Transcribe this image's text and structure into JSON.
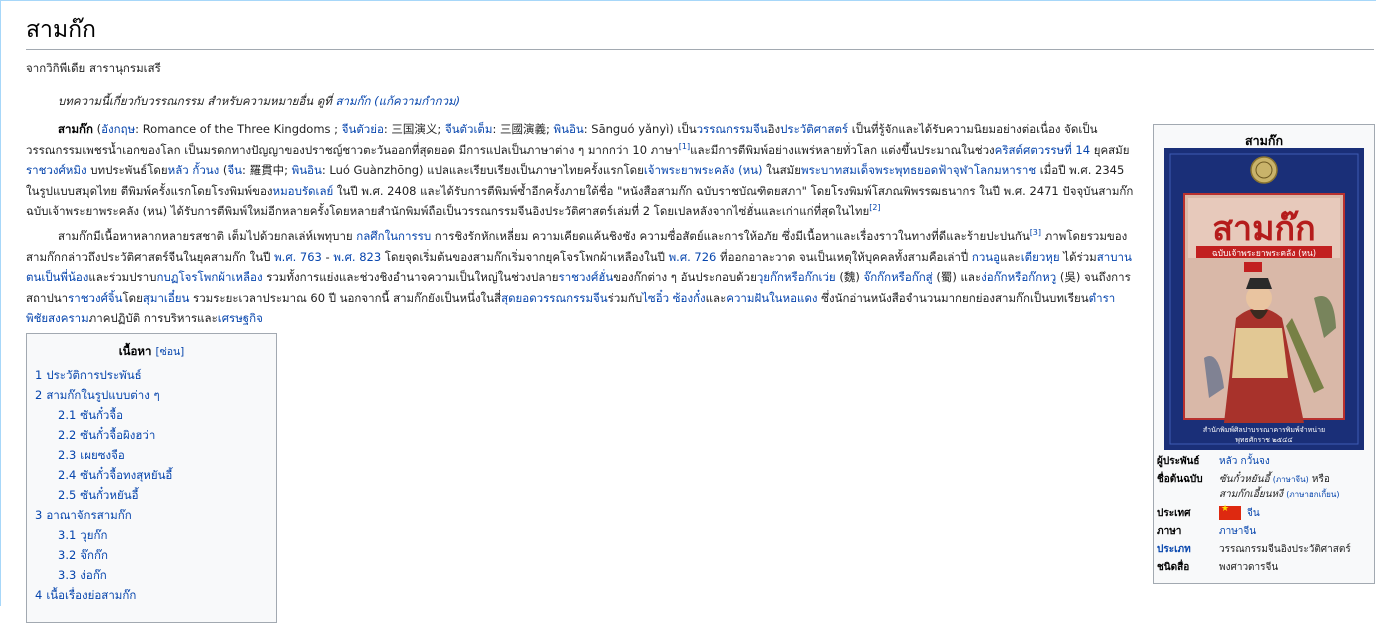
{
  "page": {
    "title": "สามก๊ก",
    "site_sub": "จากวิกิพีเดีย สารานุกรมเสรี",
    "hatnote": {
      "text": "บทความนี้เกี่ยวกับวรรณกรรม สำหรับความหมายอื่น ดูที่ ",
      "link": "สามก๊ก (แก้ความกำกวม)"
    }
  },
  "paragraph1": {
    "bold": "สามก๊ก",
    "t1": " (",
    "l_english": "อังกฤษ",
    "t2": ": Romance of the Three Kingdoms ; ",
    "l_simp": "จีนตัวย่อ",
    "t3": ": 三国演义; ",
    "l_trad": "จีนตัวเต็ม",
    "t4": ": 三國演義; ",
    "l_pinyin": "พินอิน",
    "t5": ": Sānguó yǎnyì) เป็น",
    "l_lit": "วรรณกรรม",
    "l_china": "จีน",
    "t6": "อิง",
    "l_hist": "ประวัติศาสตร์",
    "t7": " เป็นที่รู้จักและได้รับความนิยมอย่างต่อเนื่อง จัดเป็นวรรณกรรมเพชรน้ำเอกของโลก เป็นมรดกทางปัญญาของปราชญ์ชาวตะวันออกที่สุดยอด มีการแปลเป็นภาษาต่าง ๆ มากกว่า 10 ภาษา",
    "ref1": "[1]",
    "t8": "และมีการตีพิมพ์อย่างแพร่หลายทั่วโลก แต่งขึ้นประมาณในช่วง",
    "l_century": "คริสต์ศตวรรษที่ 14",
    "t9": " ยุคสมัย",
    "l_ming": "ราชวงศ์หมิง",
    "t10": " บทประพันธ์โดย",
    "l_luo": "หลัว กั้วนง",
    "t11": " (",
    "l_china2": "จีน",
    "t12": ": 羅貫中; ",
    "l_pinyin2": "พินอิน",
    "t13": ": Luó Guànzhōng) แปลและเรียบเรียงเป็นภาษาไทยครั้งแรกโดย",
    "l_hon": "เจ้าพระยาพระคลัง (หน)",
    "t14": " ในสมัย",
    "l_king": "พระบาทสมเด็จพระพุทธยอดฟ้าจุฬาโลกมหาราช",
    "t15": " เมื่อปี พ.ศ. 2345 ในรูปแบบสมุดไทย ตีพิมพ์ครั้งแรกโดยโรงพิมพ์ของ",
    "l_bradley": "หมอบรัดเลย์",
    "t16": " ในปี พ.ศ. 2408 และได้รับการตีพิมพ์ซ้ำอีกครั้งภายใต้ชื่อ \"หนังสือสามก๊ก ฉบับราชบัณฑิตยสภา\" โดยโรงพิมพ์โสภณพิพรรฒธนากร ในปี พ.ศ. 2471 ปัจจุบันสามก๊กฉบับเจ้าพระยาพระคลัง (หน) ได้รับการตีพิมพ์ใหม่อีกหลายครั้งโดยหลายสำนักพิมพ์ถือเป็นวรรณกรรมจีนอิงประวัติศาสตร์เล่มที่ 2 โดยเปลหลังจากไซ่ฮั่นและเก่าแก่ที่สุดในไทย",
    "ref2": "[2]"
  },
  "paragraph2": {
    "t1": "สามก๊กมีเนื้อหาหลากหลายรสชาติ เต็มไปด้วยกลเล่ห์เพทุบาย ",
    "l_tactics": "กลศึกในการรบ",
    "t2": " การชิงรักหักเหลี่ยม ความเคียดแค้นชิงชัง ความซื่อสัตย์และการให้อภัย ซึ่งมีเนื้อหาและเรื่องราวในทางที่ดีและร้ายปะปนกัน",
    "ref3": "[3]",
    "t3": " ภาพโดยรวมของสามก๊กกล่าวถึงประวัติศาสตร์จีนในยุคสามก๊ก ในปี ",
    "l_763": "พ.ศ. 763",
    "t4": " - ",
    "l_823": "พ.ศ. 823",
    "t5": " โดยจุดเริ่มต้นของสามก๊กเริ่มจากยุคโจรโพกผ้าเหลืองในปี ",
    "l_726": "พ.ศ. 726",
    "t6": " ที่ออกอาละวาด จนเป็นเหตุให้บุคคลทั้งสามคือเล่าปี่ ",
    "l_guanyu": "กวนอู",
    "t7": "และ",
    "l_zhangfei": "เตียวหุย",
    "t8": " ได้ร่วม",
    "l_oath": "สาบานตนเป็นพี่น้อง",
    "t9": "และร่วมปราบ",
    "l_rebels": "กบฏโจรโพกผ้าเหลือง",
    "t10": " รวมทั้งการแย่งและช่วงชิงอำนาจความเป็นใหญ่ในช่วงปลาย",
    "l_han": "ราชวงศ์ฮั่น",
    "t11": "ของก๊กต่าง ๆ อันประกอบด้วย",
    "l_wei": "วุยก๊กหรือก๊กเว่ย",
    "t12": " (魏) ",
    "l_shu": "จ๊กก๊กหรือก๊กสู่",
    "t13": " (蜀) และ",
    "l_wu": "ง่อก๊กหรือก๊กหวู",
    "t14": " (吳) จนถึงการสถาปนา",
    "l_jin": "ราชวงศ์จิ้น",
    "t15": "โดย",
    "l_sima": "สุมาเอี๋ยน",
    "t16": " รวมระยะเวลาประมาณ 60 ปี นอกจากนี้ สามก๊กยังเป็นหนึ่งในสี่",
    "l_four": "สุดยอดวรรณกรรมจีน",
    "t17": "ร่วมกับ",
    "l_xiyou": "ไซอิ๋ว",
    "t18": " ",
    "l_water": "ซ้องกั๋ง",
    "t19": "และ",
    "l_dream": "ความฝันในหอแดง",
    "t20": " ซึ่งนักอ่านหนังสือจำนวนมากยกย่องสามก๊กเป็นบทเรียน",
    "l_war": "ตำราพิชัยสงคราม",
    "t21": "ภาคปฏิบัติ การบริหารและ",
    "l_econ": "เศรษฐกิจ"
  },
  "toc": {
    "title": "เนื้อหา",
    "toggle": "[ซ่อน]",
    "items": [
      {
        "num": "1",
        "label": "ประวัติการประพันธ์",
        "level": 1
      },
      {
        "num": "2",
        "label": "สามก๊กในรูปแบบต่าง ๆ",
        "level": 1
      },
      {
        "num": "2.1",
        "label": "ซันกั๋วจื้อ",
        "level": 2
      },
      {
        "num": "2.2",
        "label": "ซันกั๋วจื้อผิงฮว่า",
        "level": 2
      },
      {
        "num": "2.3",
        "label": "เผยซงจือ",
        "level": 2
      },
      {
        "num": "2.4",
        "label": "ซันกั๋วจื้อทงสุหยันอี้",
        "level": 2
      },
      {
        "num": "2.5",
        "label": "ซันกั๋วหยันอี้",
        "level": 2
      },
      {
        "num": "3",
        "label": "อาณาจักรสามก๊ก",
        "level": 1
      },
      {
        "num": "3.1",
        "label": "วุยก๊ก",
        "level": 2
      },
      {
        "num": "3.2",
        "label": "จ๊กก๊ก",
        "level": 2
      },
      {
        "num": "3.3",
        "label": "ง่อก๊ก",
        "level": 2
      },
      {
        "num": "4",
        "label": "เนื้อเรื่องย่อสามก๊ก",
        "level": 1
      }
    ]
  },
  "infobox": {
    "title": "สามก๊ก",
    "cover": {
      "title_text": "สามก๊ก",
      "subtitle": "ฉบับเจ้าพระยาพระคลัง (หน)",
      "footer1": "สำนักพิมพ์ศิลปาบรรณาคารพิมพ์จำหน่าย",
      "footer2": "พุทธศักราช ๒๕๔๔"
    },
    "rows": {
      "author_label": "ผู้ประพันธ์",
      "author_value": "หลัว กวั้นจง",
      "orig_label": "ชื่อต้นฉบับ",
      "orig_value1": "ซันกั๋วหยันอี้",
      "orig_note1": "(ภาษาจีน)",
      "orig_or": "หรือ",
      "orig_value2": "สามก๊กเอี้ยนหงี",
      "orig_note2": "(ภาษาฮกเกี้ยน)",
      "country_label": "ประเทศ",
      "country_value": "จีน",
      "lang_label": "ภาษา",
      "lang_value": "ภาษาจีน",
      "genre_label": "ประเภท",
      "genre_value": "วรรณกรรมจีนอิงประวัติศาสตร์",
      "type_label": "ชนิดสื่อ",
      "type_value": "พงศาวดารจีน"
    }
  },
  "colors": {
    "link": "#0645ad",
    "border": "#a2a9b1",
    "box_bg": "#f8f9fa",
    "cover_bg": "#1a2f78",
    "flag_red": "#de2910"
  }
}
